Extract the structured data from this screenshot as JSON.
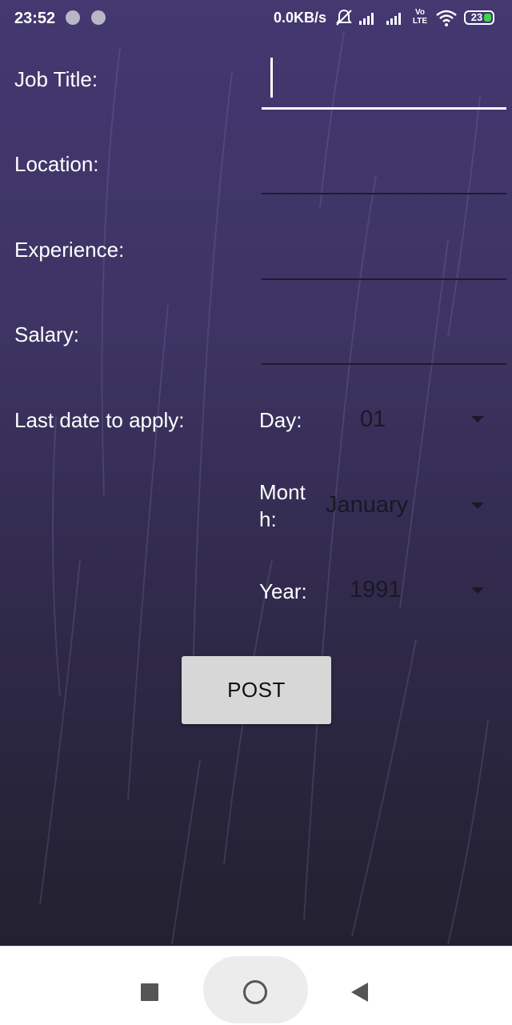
{
  "status_bar": {
    "time": "23:52",
    "net_speed": "0.0KB/s",
    "volte": "Vo LTE",
    "battery": "23"
  },
  "form": {
    "job_title_label": "Job Title:",
    "location_label": "Location:",
    "experience_label": "Experience:",
    "salary_label": "Salary:",
    "last_date_label": "Last date to apply:",
    "job_title_value": "",
    "location_value": "",
    "experience_value": "",
    "salary_value": "",
    "day_label": "Day:",
    "day_value": "01",
    "month_label_line1": "Mont",
    "month_label_line2": "h:",
    "month_value": "January",
    "year_label": "Year:",
    "year_value": "1991",
    "post_button": "POST"
  },
  "colors": {
    "background_top": "#433870",
    "background_bottom": "#232130",
    "button_bg": "#d7d7d7",
    "battery_fill": "#3fd24a"
  },
  "icons": [
    "dot-icon",
    "mute-bell-icon",
    "signal-icon",
    "wifi-icon",
    "battery-icon",
    "dropdown-caret-icon",
    "recent-apps-icon",
    "home-icon",
    "back-icon"
  ]
}
